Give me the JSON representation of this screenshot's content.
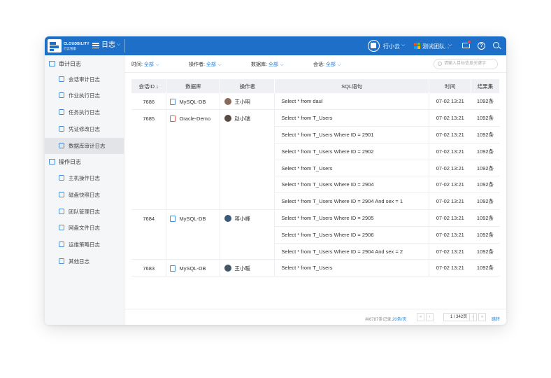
{
  "header": {
    "brand": "CLOUDBILITY",
    "brand_sub": "行云管家",
    "module": "日志",
    "user": "行小云",
    "team": "测试团队...",
    "help": "?"
  },
  "sidebar": {
    "groups": [
      {
        "label": "审计日志",
        "items": [
          "会话审计日志",
          "作业执行日志",
          "任务执行日志",
          "凭证修改日志",
          "数据库审计日志"
        ]
      },
      {
        "label": "操作日志",
        "items": [
          "主机操作日志",
          "磁盘快照日志",
          "团队管理日志",
          "网盘文件日志",
          "运维策略日志",
          "其他日志"
        ]
      }
    ],
    "active_item": "数据库审计日志"
  },
  "filters": [
    {
      "label": "时间:",
      "value": "全部"
    },
    {
      "label": "操作者:",
      "value": "全部"
    },
    {
      "label": "数据库:",
      "value": "全部"
    },
    {
      "label": "会话:",
      "value": "全部"
    }
  ],
  "search": {
    "placeholder": "请输入目标信息关键字"
  },
  "table": {
    "columns": [
      "会话ID ↓",
      "数据库",
      "操作者",
      "SQL语句",
      "时间",
      "结果集"
    ],
    "sessions": [
      {
        "id": "7686",
        "db": "MySQL-DB",
        "operator": "王小明"
      },
      {
        "id": "7685",
        "db": "Oracle-Demo",
        "operator": "赵小瑞"
      },
      {
        "id": "7684",
        "db": "MySQL-DB",
        "operator": "蒋小峰"
      },
      {
        "id": "7683",
        "db": "MySQL-DB",
        "operator": "王小暖"
      }
    ],
    "rows": [
      {
        "sql": "Select * from daul",
        "time": "07-02 13:21",
        "result": "1092条"
      },
      {
        "sql": "Select * from T_Users",
        "time": "07-02 13:21",
        "result": "1092条"
      },
      {
        "sql": "Select * from T_Users  Where ID = 2901",
        "time": "07-02 13:21",
        "result": "1092条"
      },
      {
        "sql": "Select * from T_Users  Where ID = 2902",
        "time": "07-02 13:21",
        "result": "1092条"
      },
      {
        "sql": "Select * from T_Users",
        "time": "07-02 13:21",
        "result": "1092条"
      },
      {
        "sql": "Select * from T_Users  Where ID = 2904",
        "time": "07-02 13:21",
        "result": "1092条"
      },
      {
        "sql": "Select * from T_Users  Where ID = 2904 And sex = 1",
        "time": "07-02 13:21",
        "result": "1092条"
      },
      {
        "sql": "Select * from T_Users  Where ID = 2905",
        "time": "07-02 13:21",
        "result": "1092条"
      },
      {
        "sql": "Select * from T_Users  Where ID = 2906",
        "time": "07-02 13:21",
        "result": "1092条"
      },
      {
        "sql": "Select * from T_Users  Where ID = 2904 And sex = 2",
        "time": "07-02 13:21",
        "result": "1092条"
      },
      {
        "sql": "Select * from T_Users",
        "time": "07-02 13:21",
        "result": "1092条"
      }
    ]
  },
  "pagination": {
    "total_prefix": "共6787条记录,",
    "per_page": "20条/页",
    "first": "«",
    "prev": "‹",
    "page": "1 / 342页",
    "next": "›",
    "last": "»",
    "jump": "跳转"
  },
  "colors": {
    "accent": "#1e6fc8",
    "link": "#1e80e0",
    "active_bg": "#e2e4e8"
  }
}
